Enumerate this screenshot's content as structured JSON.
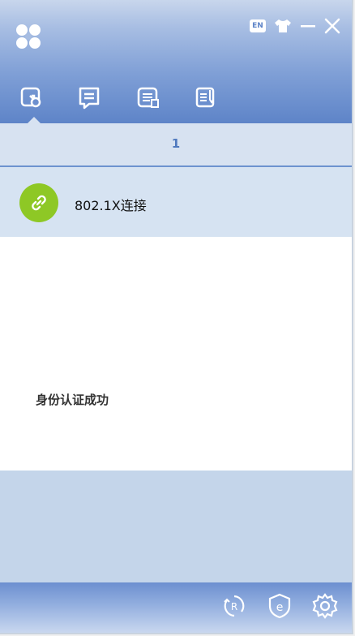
{
  "header": {
    "lang_badge": "EN"
  },
  "tabs": [
    {
      "icon": "connection-icon"
    },
    {
      "icon": "message-icon"
    },
    {
      "icon": "list-icon"
    },
    {
      "icon": "notes-icon"
    }
  ],
  "pagination": {
    "current_page": "1"
  },
  "connection": {
    "name": "802.1X连接"
  },
  "status": {
    "message": "身份认证成功"
  },
  "colors": {
    "accent": "#5e84c8",
    "connected": "#8ec825"
  }
}
